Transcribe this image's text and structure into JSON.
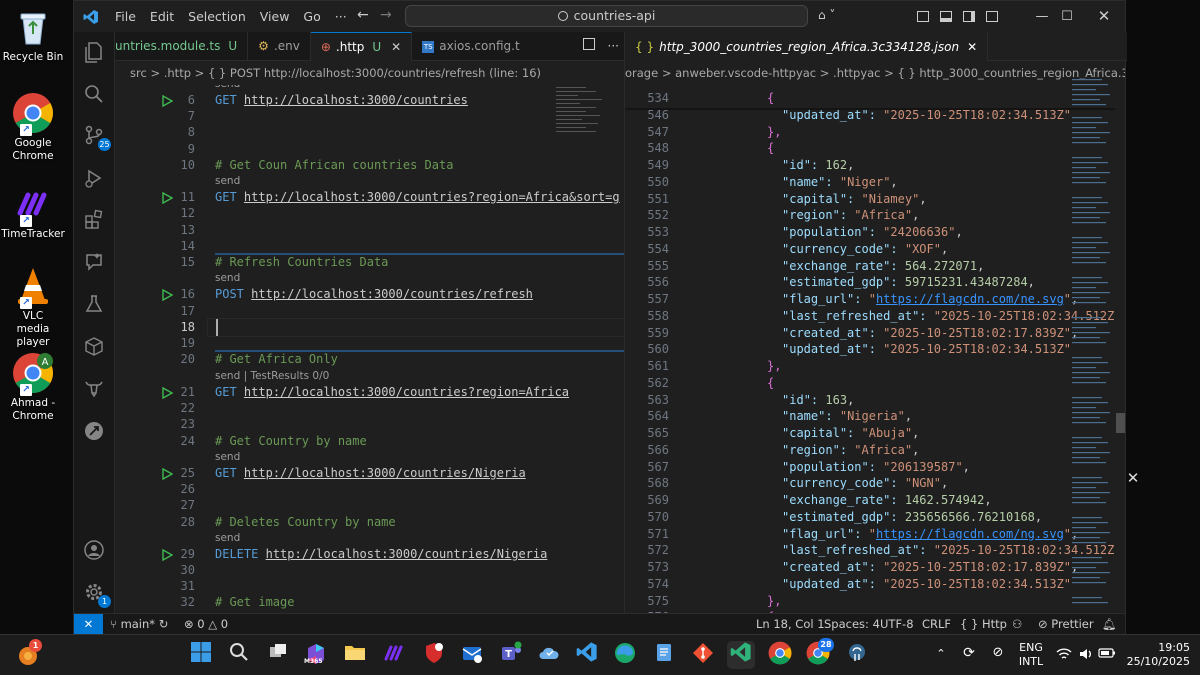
{
  "desktop": {
    "icons": [
      {
        "label": "Recycle Bin"
      },
      {
        "label": "Google Chrome"
      },
      {
        "label": "TimeTracker"
      },
      {
        "label": "VLC media player"
      },
      {
        "label": "Ahmad - Chrome"
      }
    ]
  },
  "titlebar": {
    "menus": [
      "File",
      "Edit",
      "Selection",
      "View",
      "Go"
    ],
    "search_text": "countries-api",
    "more": "···"
  },
  "activity": {
    "scm_badge": "25",
    "settings_badge": "1"
  },
  "left_editor": {
    "tabs": [
      {
        "label": "untries.module.ts",
        "status": "U"
      },
      {
        "label": ".env",
        "status": ""
      },
      {
        "label": ".http",
        "status": "U"
      },
      {
        "label": "axios.config.t",
        "status": ""
      }
    ],
    "breadcrumb": "src > .http > { } POST http://localhost:3000/countries/refresh (line: 16)",
    "lines": [
      {
        "n": "6",
        "send": "send",
        "method": "GET",
        "url": "http://localhost:3000/countries",
        "rest": ""
      },
      {
        "n": "7"
      },
      {
        "n": "8"
      },
      {
        "n": "9"
      },
      {
        "n": "10",
        "comment": "# Get Coun African countries Data"
      },
      {
        "n": "11",
        "send": "send",
        "method": "GET",
        "url": "http://localhost:3000/countries?region=Africa&sort=g",
        "rest": ""
      },
      {
        "n": "12"
      },
      {
        "n": "13"
      },
      {
        "n": "14"
      },
      {
        "n": "15",
        "comment": "# Refresh Countries Data"
      },
      {
        "n": "16",
        "send": "send",
        "method": "POST",
        "url": "http://localhost:3000/countries/refresh",
        "rest": ""
      },
      {
        "n": "17"
      },
      {
        "n": "18"
      },
      {
        "n": "19"
      },
      {
        "n": "20",
        "comment": "# Get Africa Only"
      },
      {
        "n": "21",
        "send": "send | TestResults 0/0",
        "method": "GET",
        "url": "http://localhost:3000/countries?region=Africa",
        "rest": ""
      },
      {
        "n": "22"
      },
      {
        "n": "23"
      },
      {
        "n": "24",
        "comment": "# Get Country by name"
      },
      {
        "n": "25",
        "send": "send",
        "method": "GET",
        "url": "http://localhost:3000/countries/Nigeria",
        "rest": ""
      },
      {
        "n": "26"
      },
      {
        "n": "27"
      },
      {
        "n": "28",
        "comment": "# Deletes Country by name"
      },
      {
        "n": "29",
        "send": "send",
        "method": "DELETE",
        "url": "http://localhost:3000/countries/Nigeria",
        "rest": ""
      },
      {
        "n": "30"
      },
      {
        "n": "31"
      },
      {
        "n": "32",
        "comment": "# Get image"
      }
    ]
  },
  "right_editor": {
    "tab": "http_3000_countries_region_Africa.3c334128.json",
    "breadcrumb": "orage > anweber.vscode-httpyac > .httpyac > { } http_3000_countries_region_Africa.3c334128.json",
    "lines": [
      {
        "n": "534",
        "t": "{"
      },
      {
        "n": "546",
        "k": "updated_at",
        "v": "2025-10-25T18:02:34.513Z",
        "vt": "s",
        "c": ""
      },
      {
        "n": "547",
        "t": "},"
      },
      {
        "n": "548",
        "t": "{"
      },
      {
        "n": "549",
        "k": "id",
        "v": "162",
        "vt": "n",
        "c": ","
      },
      {
        "n": "550",
        "k": "name",
        "v": "Niger",
        "vt": "s",
        "c": ","
      },
      {
        "n": "551",
        "k": "capital",
        "v": "Niamey",
        "vt": "s",
        "c": ","
      },
      {
        "n": "552",
        "k": "region",
        "v": "Africa",
        "vt": "s",
        "c": ","
      },
      {
        "n": "553",
        "k": "population",
        "v": "24206636",
        "vt": "s",
        "c": ","
      },
      {
        "n": "554",
        "k": "currency_code",
        "v": "XOF",
        "vt": "s",
        "c": ","
      },
      {
        "n": "555",
        "k": "exchange_rate",
        "v": "564.272071",
        "vt": "n",
        "c": ","
      },
      {
        "n": "556",
        "k": "estimated_gdp",
        "v": "59715231.43487284",
        "vt": "n",
        "c": ","
      },
      {
        "n": "557",
        "k": "flag_url",
        "v": "https://flagcdn.com/ne.svg",
        "vt": "u",
        "c": ","
      },
      {
        "n": "558",
        "k": "last_refreshed_at",
        "v": "2025-10-25T18:02:34.512Z",
        "vt": "s",
        "c": ","
      },
      {
        "n": "559",
        "k": "created_at",
        "v": "2025-10-25T18:02:17.839Z",
        "vt": "s",
        "c": ","
      },
      {
        "n": "560",
        "k": "updated_at",
        "v": "2025-10-25T18:02:34.513Z",
        "vt": "s",
        "c": ""
      },
      {
        "n": "561",
        "t": "},"
      },
      {
        "n": "562",
        "t": "{"
      },
      {
        "n": "563",
        "k": "id",
        "v": "163",
        "vt": "n",
        "c": ","
      },
      {
        "n": "564",
        "k": "name",
        "v": "Nigeria",
        "vt": "s",
        "c": ","
      },
      {
        "n": "565",
        "k": "capital",
        "v": "Abuja",
        "vt": "s",
        "c": ","
      },
      {
        "n": "566",
        "k": "region",
        "v": "Africa",
        "vt": "s",
        "c": ","
      },
      {
        "n": "567",
        "k": "population",
        "v": "206139587",
        "vt": "s",
        "c": ","
      },
      {
        "n": "568",
        "k": "currency_code",
        "v": "NGN",
        "vt": "s",
        "c": ","
      },
      {
        "n": "569",
        "k": "exchange_rate",
        "v": "1462.574942",
        "vt": "n",
        "c": ","
      },
      {
        "n": "570",
        "k": "estimated_gdp",
        "v": "235656566.76210168",
        "vt": "n",
        "c": ","
      },
      {
        "n": "571",
        "k": "flag_url",
        "v": "https://flagcdn.com/ng.svg",
        "vt": "u",
        "c": ","
      },
      {
        "n": "572",
        "k": "last_refreshed_at",
        "v": "2025-10-25T18:02:34.512Z",
        "vt": "s",
        "c": ","
      },
      {
        "n": "573",
        "k": "created_at",
        "v": "2025-10-25T18:02:17.839Z",
        "vt": "s",
        "c": ","
      },
      {
        "n": "574",
        "k": "updated_at",
        "v": "2025-10-25T18:02:34.513Z",
        "vt": "s",
        "c": ""
      },
      {
        "n": "575",
        "t": "},"
      },
      {
        "n": "576",
        "t": "{"
      }
    ]
  },
  "statusbar": {
    "branch": "main*",
    "problems": "0",
    "warnings": "0",
    "position": "Ln 18, Col 1",
    "spaces": "Spaces: 4",
    "encoding": "UTF-8",
    "eol": "CRLF",
    "language": "{ } Http",
    "prettier": "Prettier"
  },
  "taskbar": {
    "lang1": "ENG",
    "lang2": "INTL",
    "time": "19:05",
    "date": "25/10/2025",
    "chrome_badge": "28",
    "m365": "M365",
    "notif_badge": "1"
  },
  "colors": {
    "accent": "#0078d4",
    "comment": "#6a9955",
    "keyword": "#569cd6",
    "json_key": "#9cdcfe",
    "json_string": "#ce9178",
    "json_number": "#b5cea8"
  }
}
